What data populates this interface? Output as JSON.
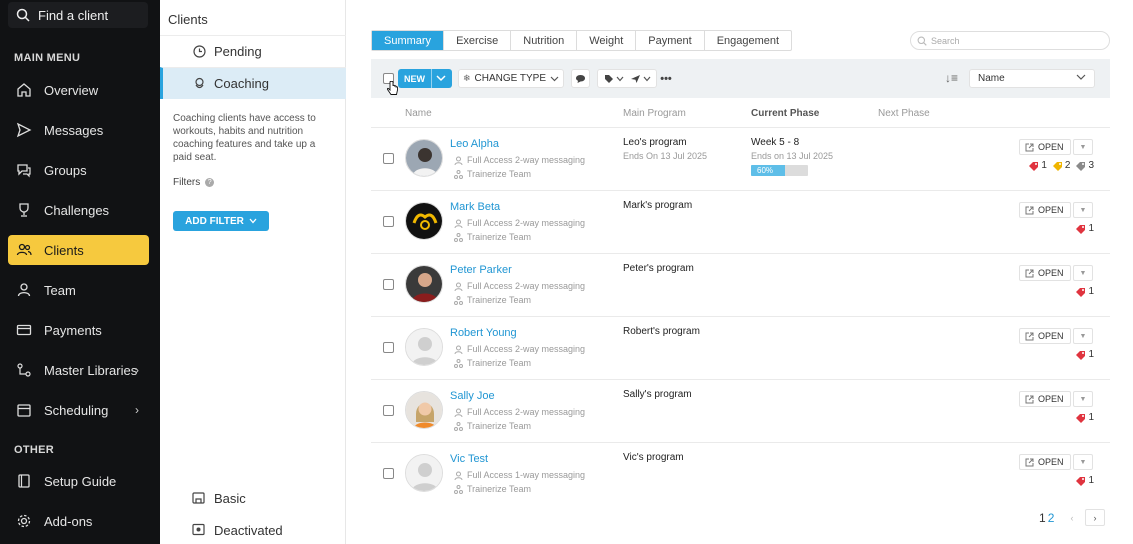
{
  "nav": {
    "search_label": "Find a client",
    "main_menu_label": "MAIN MENU",
    "other_label": "OTHER",
    "items": [
      {
        "label": "Overview",
        "icon": "home-icon"
      },
      {
        "label": "Messages",
        "icon": "send-icon"
      },
      {
        "label": "Groups",
        "icon": "chat-icon"
      },
      {
        "label": "Challenges",
        "icon": "trophy-icon"
      },
      {
        "label": "Clients",
        "icon": "people-icon",
        "active": true
      },
      {
        "label": "Team",
        "icon": "person-icon"
      },
      {
        "label": "Payments",
        "icon": "card-icon"
      },
      {
        "label": "Master Libraries",
        "icon": "library-icon"
      },
      {
        "label": "Scheduling",
        "icon": "calendar-icon"
      }
    ],
    "other_items": [
      {
        "label": "Setup Guide",
        "icon": "book-icon"
      },
      {
        "label": "Add-ons",
        "icon": "gear-icon"
      }
    ]
  },
  "subpanel": {
    "title": "Clients",
    "items": [
      {
        "label": "Pending",
        "icon": "clock-icon"
      },
      {
        "label": "Coaching",
        "icon": "whistle-icon",
        "active": true
      }
    ],
    "description": "Coaching clients have access to workouts, habits and nutrition coaching features and take up a paid seat.",
    "filters_label": "Filters",
    "add_filter_label": "ADD FILTER",
    "bottom_items": [
      {
        "label": "Basic",
        "icon": "basic-icon"
      },
      {
        "label": "Deactivated",
        "icon": "deactivated-icon"
      }
    ]
  },
  "main": {
    "tabs": [
      "Summary",
      "Exercise",
      "Nutrition",
      "Weight",
      "Payment",
      "Engagement"
    ],
    "search_placeholder": "Search",
    "toolbar": {
      "new_label": "NEW",
      "change_type_label": "CHANGE TYPE",
      "sort_value": "Name"
    },
    "columns": {
      "name": "Name",
      "main_program": "Main Program",
      "current_phase": "Current Phase",
      "next_phase": "Next Phase"
    },
    "rows": [
      {
        "name": "Leo Alpha",
        "access": "Full Access 2-way messaging",
        "team": "Trainerize Team",
        "program": "Leo's program",
        "program_sub": "Ends On 13 Jul 2025",
        "phase": "Week 5 - 8",
        "phase_sub": "Ends on 13 Jul 2025",
        "progress": "60%",
        "progress_value": 0.6,
        "open": "OPEN",
        "tags": [
          {
            "color": "#e0343f",
            "count": "1"
          },
          {
            "color": "#f0b500",
            "count": "2"
          },
          {
            "color": "#8a8a8a",
            "count": "3"
          }
        ]
      },
      {
        "name": "Mark Beta",
        "access": "Full Access 2-way messaging",
        "team": "Trainerize Team",
        "program": "Mark's program",
        "open": "OPEN",
        "tags": [
          {
            "color": "#e0343f",
            "count": "1"
          }
        ]
      },
      {
        "name": "Peter Parker",
        "access": "Full Access 2-way messaging",
        "team": "Trainerize Team",
        "program": "Peter's program",
        "open": "OPEN",
        "tags": [
          {
            "color": "#e0343f",
            "count": "1"
          }
        ]
      },
      {
        "name": "Robert Young",
        "access": "Full Access 2-way messaging",
        "team": "Trainerize Team",
        "program": "Robert's program",
        "open": "OPEN",
        "tags": [
          {
            "color": "#e0343f",
            "count": "1"
          }
        ]
      },
      {
        "name": "Sally Joe",
        "access": "Full Access 2-way messaging",
        "team": "Trainerize Team",
        "program": "Sally's program",
        "open": "OPEN",
        "tags": [
          {
            "color": "#e0343f",
            "count": "1"
          }
        ]
      },
      {
        "name": "Vic Test",
        "access": "Full Access 1-way messaging",
        "team": "Trainerize Team",
        "program": "Vic's program",
        "open": "OPEN",
        "tags": [
          {
            "color": "#e0343f",
            "count": "1"
          }
        ]
      }
    ],
    "pager": {
      "page1": "1",
      "page2": "2"
    }
  },
  "colors": {
    "accent": "#29a3de",
    "nav_active": "#f6c93e",
    "link": "#2196d3",
    "tag_red": "#e0343f",
    "tag_yellow": "#f0b500",
    "tag_gray": "#8a8a8a"
  }
}
